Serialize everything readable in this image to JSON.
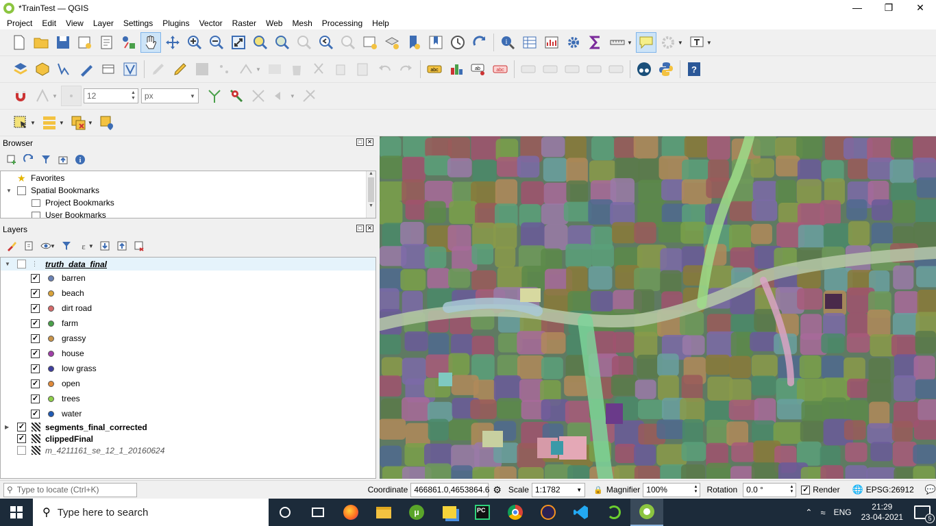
{
  "window": {
    "title": "*TrainTest — QGIS"
  },
  "menu": [
    "Project",
    "Edit",
    "View",
    "Layer",
    "Settings",
    "Plugins",
    "Vector",
    "Raster",
    "Web",
    "Mesh",
    "Processing",
    "Help"
  ],
  "snapping": {
    "tolerance": "12",
    "unit": "px"
  },
  "browser": {
    "title": "Browser",
    "items": [
      {
        "label": "Favorites",
        "icon": "star-icon"
      },
      {
        "label": "Spatial Bookmarks",
        "icon": "bookmark-icon"
      },
      {
        "label": "Project Bookmarks",
        "icon": "folder-icon"
      },
      {
        "label": "User Bookmarks",
        "icon": "folder-icon"
      }
    ]
  },
  "layers": {
    "title": "Layers",
    "group": {
      "name": "truth_data_final"
    },
    "classes": [
      {
        "label": "barren",
        "color": "#6b82b4"
      },
      {
        "label": "beach",
        "color": "#d9a33a"
      },
      {
        "label": "dirt road",
        "color": "#d46a6a"
      },
      {
        "label": "farm",
        "color": "#4aa04a"
      },
      {
        "label": "grassy",
        "color": "#c8944a"
      },
      {
        "label": "house",
        "color": "#a03fa8"
      },
      {
        "label": "low grass",
        "color": "#3f3f9e"
      },
      {
        "label": "open",
        "color": "#e08a3a"
      },
      {
        "label": "trees",
        "color": "#8fcf4a"
      },
      {
        "label": "water",
        "color": "#1f5ab4"
      }
    ],
    "others": [
      {
        "name": "segments_final_corrected",
        "checked": true,
        "bold": true
      },
      {
        "name": "clippedFinal",
        "checked": true,
        "bold": true
      },
      {
        "name": "m_4211161_se_12_1_20160624",
        "checked": false,
        "bold": false
      }
    ]
  },
  "status": {
    "locate_placeholder": "Type to locate (Ctrl+K)",
    "coordinate_label": "Coordinate",
    "coordinate": "466861.0,4653864.6",
    "scale_label": "Scale",
    "scale": "1:1782",
    "magnifier_label": "Magnifier",
    "magnifier": "100%",
    "rotation_label": "Rotation",
    "rotation": "0.0 °",
    "render_label": "Render",
    "crs": "EPSG:26912"
  },
  "taskbar": {
    "search_placeholder": "Type here to search",
    "lang": "ENG",
    "time": "21:29",
    "date": "23-04-2021",
    "notifications": "5"
  }
}
